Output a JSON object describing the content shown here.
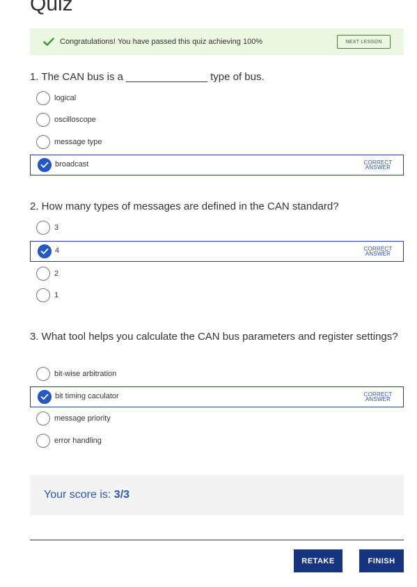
{
  "page": {
    "title": "Quiz"
  },
  "banner": {
    "icon": "checkmark-icon",
    "message": "Congratulations! You have passed this quiz achieving 100%",
    "next_label": "NEXT LESSON",
    "color": "#ecf7e1"
  },
  "correct_tag": "CORRECT ANSWER",
  "questions": [
    {
      "text": "1. The CAN bus is a ______________ type of bus.",
      "options": [
        {
          "label": "logical",
          "selected": false,
          "correct": false
        },
        {
          "label": "oscilloscope",
          "selected": false,
          "correct": false
        },
        {
          "label": "message type",
          "selected": false,
          "correct": false
        },
        {
          "label": "broadcast",
          "selected": true,
          "correct": true
        }
      ]
    },
    {
      "text": "2. How many types of messages are defined in the CAN standard?",
      "options": [
        {
          "label": "3",
          "selected": false,
          "correct": false
        },
        {
          "label": "4",
          "selected": true,
          "correct": true
        },
        {
          "label": "2",
          "selected": false,
          "correct": false
        },
        {
          "label": "1",
          "selected": false,
          "correct": false
        }
      ]
    },
    {
      "text": "3. What tool helps you calculate the CAN bus parameters and register settings?",
      "options": [
        {
          "label": "bit-wise arbitration",
          "selected": false,
          "correct": false
        },
        {
          "label": "bit timing caculator",
          "selected": true,
          "correct": true
        },
        {
          "label": "message priority",
          "selected": false,
          "correct": false
        },
        {
          "label": "error handling",
          "selected": false,
          "correct": false
        }
      ]
    }
  ],
  "score": {
    "label": "Your score is:",
    "value": "3/3"
  },
  "actions": {
    "retake_label": "RETAKE",
    "finish_label": "FINISH"
  },
  "colors": {
    "accent": "#17357f",
    "selected_radio": "#2557c6",
    "score_text": "#2857b8"
  }
}
